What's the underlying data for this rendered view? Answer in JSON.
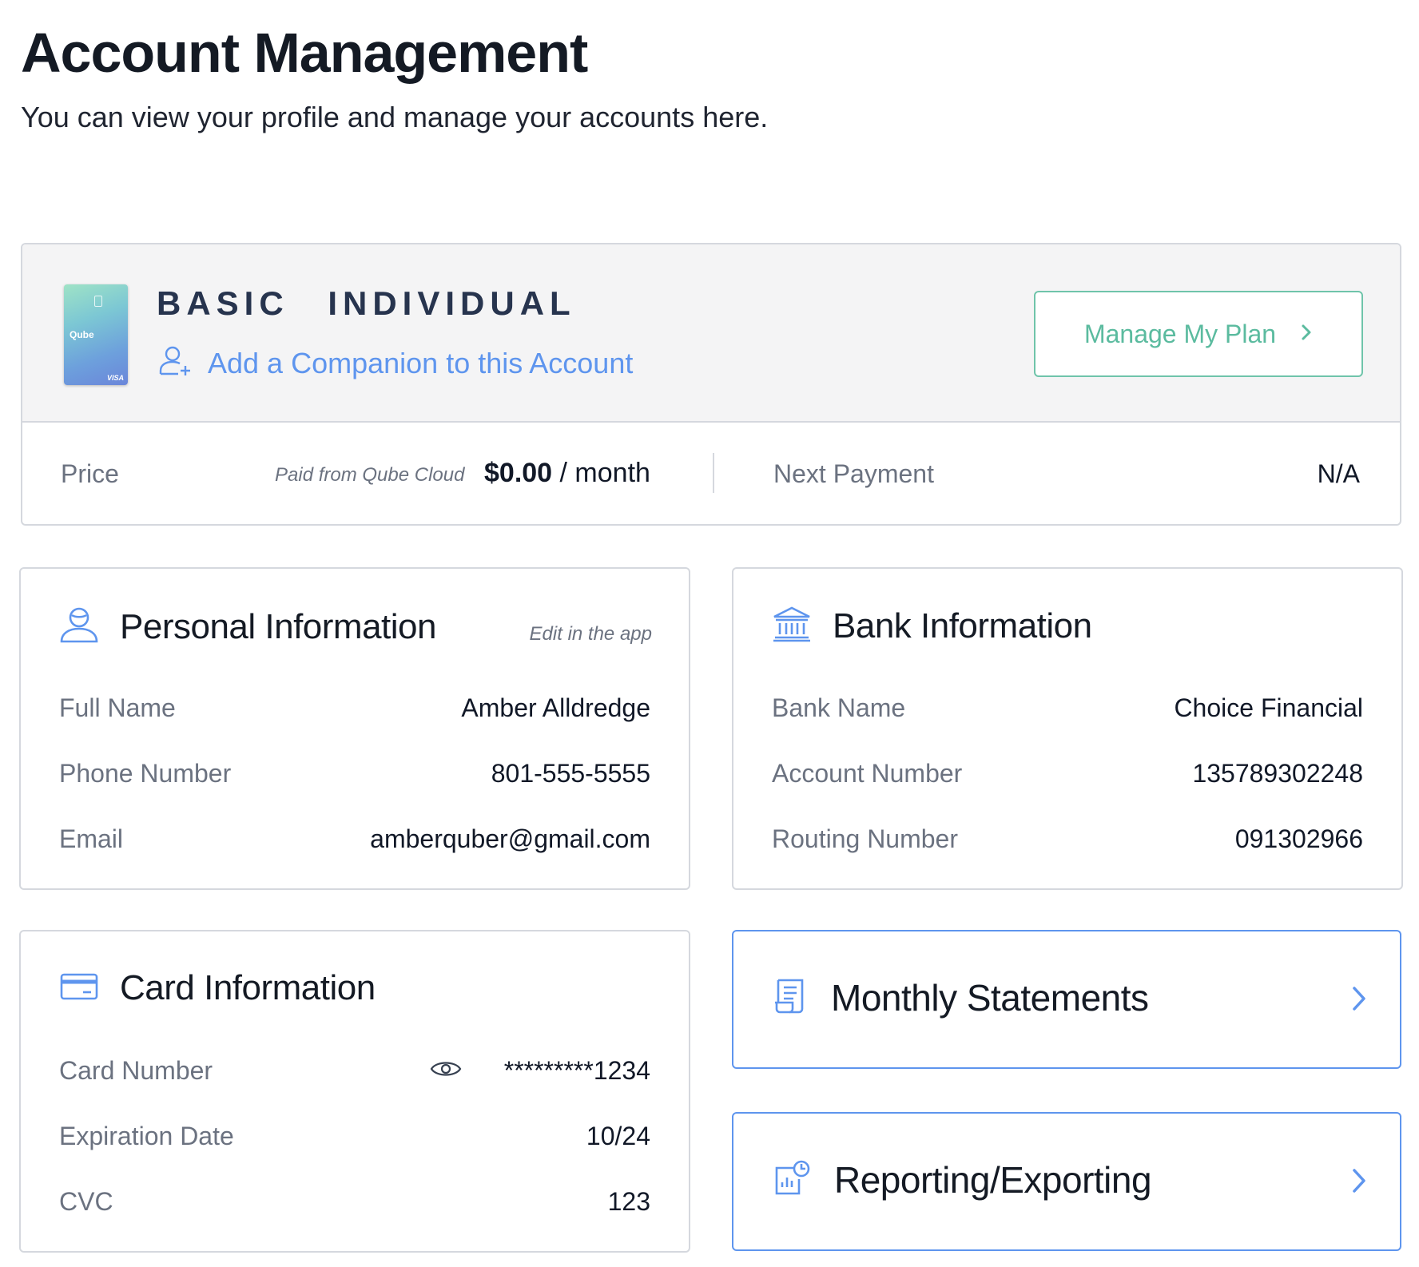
{
  "page": {
    "title": "Account Management",
    "subtitle": "You can view your profile and manage your accounts here."
  },
  "plan": {
    "card_brand": "Qube",
    "card_network": "VISA",
    "name": "BASIC INDIVIDUAL",
    "companion_link": "Add a Companion to this Account",
    "manage_button": "Manage My Plan",
    "price_label": "Price",
    "price_note": "Paid from Qube Cloud",
    "price_amount": "$0.00",
    "price_period": " / month",
    "next_payment_label": "Next Payment",
    "next_payment_value": "N/A"
  },
  "personal": {
    "title": "Personal Information",
    "edit_note": "Edit in the app",
    "rows": [
      {
        "label": "Full Name",
        "value": "Amber Alldredge"
      },
      {
        "label": "Phone Number",
        "value": "801-555-5555"
      },
      {
        "label": "Email",
        "value": "amberquber@gmail.com"
      }
    ]
  },
  "bank": {
    "title": "Bank Information",
    "rows": [
      {
        "label": "Bank Name",
        "value": "Choice Financial"
      },
      {
        "label": "Account Number",
        "value": "135789302248"
      },
      {
        "label": "Routing Number",
        "value": "091302966"
      }
    ]
  },
  "card": {
    "title": "Card Information",
    "rows": [
      {
        "label": "Card Number",
        "value": "*********1234"
      },
      {
        "label": "Expiration Date",
        "value": "10/24"
      },
      {
        "label": "CVC",
        "value": "123"
      }
    ]
  },
  "links": {
    "statements": "Monthly Statements",
    "reporting": "Reporting/Exporting"
  },
  "colors": {
    "accent_blue": "#5e95ee",
    "accent_green": "#5bbb9f",
    "text_dark": "#141a24",
    "text_muted": "#6b7280"
  }
}
